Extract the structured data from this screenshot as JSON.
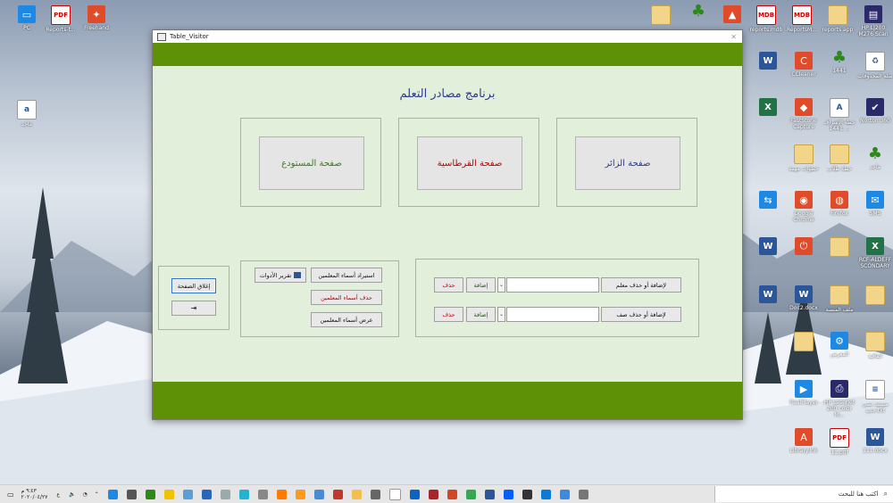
{
  "window": {
    "title": "Table_Visitor",
    "close_glyph": "✕"
  },
  "form": {
    "heading": "برنامج مصادر التعلم",
    "pages": {
      "visitor": "صفحة الزائر",
      "stationery": "صفحة القرطاسية",
      "warehouse": "صفحة المستودع"
    },
    "teacher_row": {
      "add_delete_label": "لإضافة أو حذف معلم",
      "add": "إضافة",
      "delete": "حذف",
      "value": ""
    },
    "class_row": {
      "add_delete_label": "لإضافة أو حذف صف",
      "add": "إضافة",
      "delete": "حذف",
      "value": ""
    },
    "teachers_box": {
      "import_names": "استيراد أسماء المعلمين",
      "tools_report": "تقرير الأدوات",
      "delete_names": "حذف أسماء المعلمين",
      "show_names": "عرض أسماء المعلمين"
    },
    "close_page": "إغلاق الصفحة"
  },
  "desktop_icons": [
    "Reports-t...",
    "Freehand",
    "ماجد",
    "reports.mdb",
    "ReportsM...",
    "reports app",
    "أنواع التقارير",
    "HP LJ200 M276 Scan",
    "CCleaner",
    "1441",
    "سلة المحذوفات",
    "FastStone Capture",
    "خطة الإشراف 1441 ...",
    "Norton 360",
    "خطوات مهمة",
    "خطة طلاب",
    "ماجد",
    "Google Chrome",
    "Firefox",
    "SMS",
    "RCF-ALDEFF SCONDARY",
    "Doc2.docx",
    "ملف المنصة",
    "المعرض",
    "اتفاقية",
    "HP LaserJet 200 color M...",
    "RealPlayer",
    "مستند نصي جديد.txt",
    "Library.lnk",
    "11.pdf",
    "111.docx"
  ],
  "taskbar": {
    "search_placeholder": "اكتب هنا للبحث",
    "time": "٩:٤٣ م",
    "date": "٢٠٢٠/٠٤/٢٧",
    "lang": "ع"
  },
  "colors": {
    "band": "#5f9107",
    "form_bg": "#e2efda",
    "heading": "#2e3e8c",
    "visitor_text": "#2e3e8c",
    "stationery_text": "#c00000",
    "warehouse_text": "#3a7d1e"
  }
}
